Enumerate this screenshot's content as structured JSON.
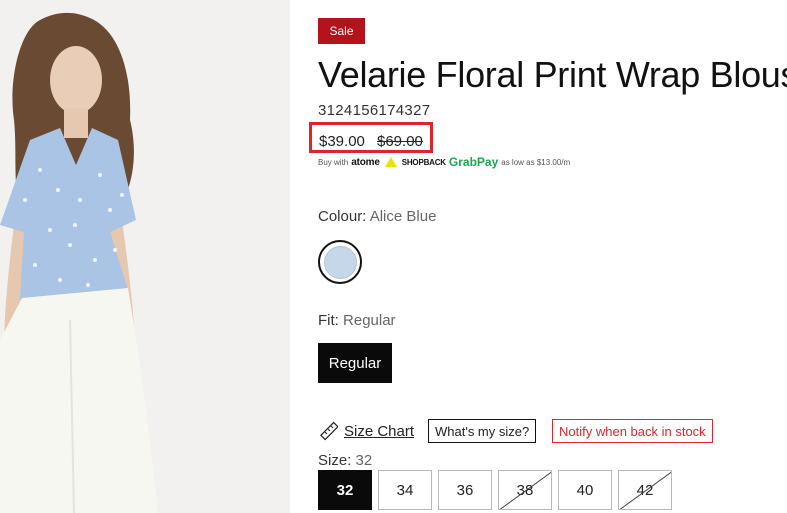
{
  "product": {
    "badge": "Sale",
    "title": "Velarie Floral Print Wrap Blouse",
    "sku": "3124156174327",
    "price_current": "$39.00",
    "price_original": "$69.00",
    "installments": {
      "prefix": "Buy with",
      "providers": [
        "atome",
        "SHOPBACK",
        "GrabPay"
      ],
      "suffix": "as low as $13.00/m"
    }
  },
  "colour": {
    "label": "Colour:",
    "value": "Alice Blue",
    "swatch_color": "#c5d7e8"
  },
  "fit": {
    "label": "Fit:",
    "value": "Regular",
    "button_label": "Regular"
  },
  "size_tools": {
    "size_chart": "Size Chart",
    "whats_my_size": "What's my size?",
    "notify": "Notify when back in stock"
  },
  "size": {
    "label": "Size:",
    "value": "32",
    "options": [
      {
        "label": "32",
        "state": "selected"
      },
      {
        "label": "34",
        "state": "available"
      },
      {
        "label": "36",
        "state": "available"
      },
      {
        "label": "38",
        "state": "unavailable"
      },
      {
        "label": "40",
        "state": "available"
      },
      {
        "label": "42",
        "state": "unavailable"
      }
    ]
  },
  "colors": {
    "sale": "#b3141b",
    "highlight": "#e0242c",
    "grabpay": "#19a84f"
  }
}
